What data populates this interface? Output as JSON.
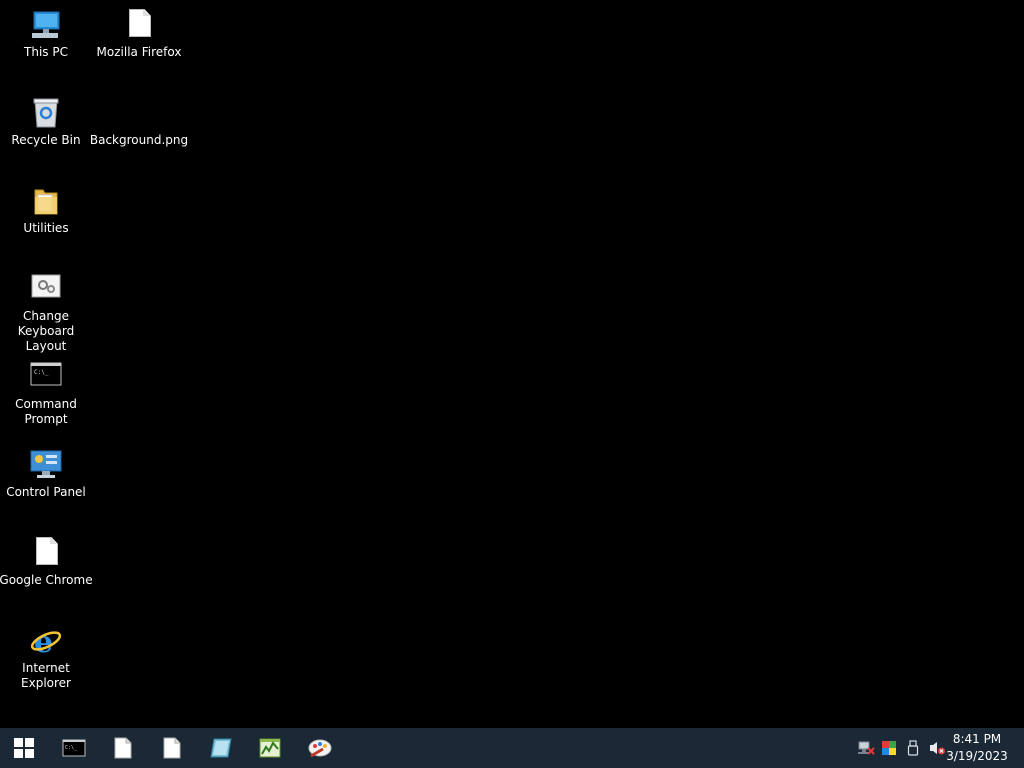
{
  "desktop": {
    "icons": [
      {
        "label": "This PC",
        "icon": "this-pc-icon"
      },
      {
        "label": "Mozilla Firefox",
        "icon": "file-icon"
      },
      {
        "label": "Recycle Bin",
        "icon": "recycle-bin-icon"
      },
      {
        "label": "Background.png",
        "icon": "image-file-icon"
      },
      {
        "label": "Utilities",
        "icon": "folder-icon"
      },
      {
        "label": "Change\nKeyboard Layout",
        "icon": "settings-gear-icon"
      },
      {
        "label": "Command\nPrompt",
        "icon": "command-prompt-icon"
      },
      {
        "label": "Control Panel",
        "icon": "control-panel-icon"
      },
      {
        "label": "Google Chrome",
        "icon": "file-icon"
      },
      {
        "label": "Internet Explorer",
        "icon": "internet-explorer-icon"
      }
    ]
  },
  "taskbar": {
    "start_icon": "windows-logo-icon",
    "pinned": [
      {
        "icon": "command-prompt-icon"
      },
      {
        "icon": "file-icon"
      },
      {
        "icon": "file-icon"
      },
      {
        "icon": "tablet-icon"
      },
      {
        "icon": "task-manager-icon"
      },
      {
        "icon": "paint-icon"
      }
    ],
    "tray": [
      {
        "icon": "network-disconnected-icon"
      },
      {
        "icon": "color-palette-icon"
      },
      {
        "icon": "usb-device-icon"
      },
      {
        "icon": "speaker-muted-icon"
      }
    ],
    "clock": {
      "time": "8:41 PM",
      "date": "3/19/2023"
    }
  },
  "colors": {
    "desktop_background": "#000000",
    "taskbar_background": "#1b2936"
  }
}
